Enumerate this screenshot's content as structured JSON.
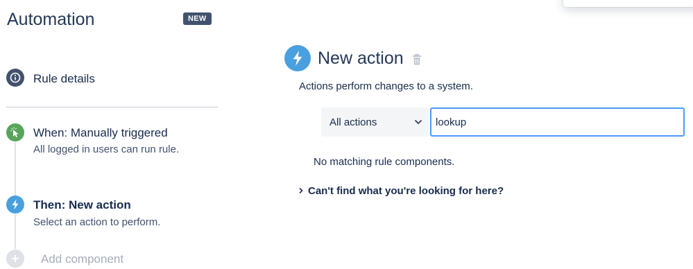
{
  "app": {
    "title": "Automation",
    "badge": "NEW"
  },
  "steps": {
    "rule_details": {
      "title": "Rule details"
    },
    "trigger": {
      "title": "When: Manually triggered",
      "subtitle": "All logged in users can run rule."
    },
    "action": {
      "title": "Then: New action",
      "subtitle": "Select an action to perform."
    },
    "add_component": {
      "label": "Add component"
    }
  },
  "panel": {
    "title": "New action",
    "description": "Actions perform changes to a system.",
    "filter_select": {
      "value": "All actions"
    },
    "search": {
      "value": "lookup"
    },
    "empty_message": "No matching rule components.",
    "help_link": "Can't find what you're looking for here?"
  },
  "colors": {
    "rule_details_icon": "#42526e",
    "trigger_icon": "#57a55a",
    "action_icon": "#4a9fde",
    "add_icon": "#dfe1e6",
    "search_border": "#4c9aff"
  }
}
